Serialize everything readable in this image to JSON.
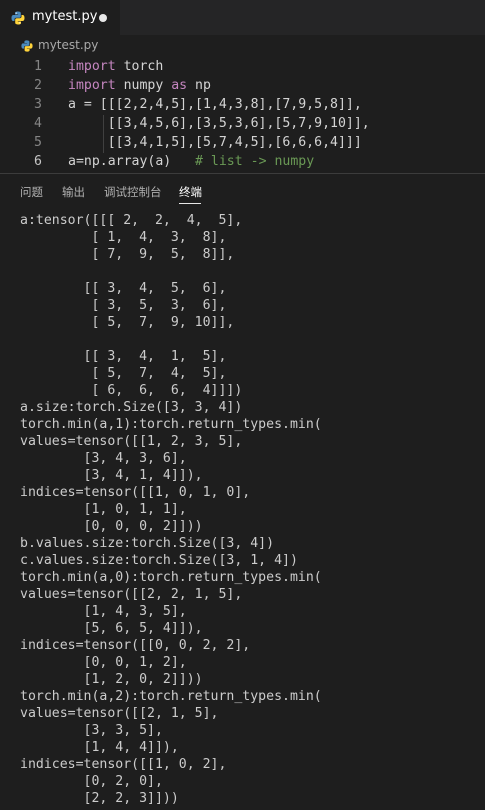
{
  "tab": {
    "filename": "mytest.py",
    "icon": "python-icon"
  },
  "breadcrumb": {
    "filename": "mytest.py"
  },
  "editor": {
    "lines": [
      {
        "number": "1",
        "code": [
          {
            "t": "import",
            "k": "kw"
          },
          {
            "t": " torch",
            "k": ""
          }
        ]
      },
      {
        "number": "2",
        "code": [
          {
            "t": "import",
            "k": "kw"
          },
          {
            "t": " numpy ",
            "k": ""
          },
          {
            "t": "as",
            "k": "kw"
          },
          {
            "t": " np",
            "k": ""
          }
        ]
      },
      {
        "number": "3",
        "code": [
          {
            "t": "a = [[[2,2,4,5],[1,4,3,8],[7,9,5,8]],",
            "k": ""
          }
        ]
      },
      {
        "number": "4",
        "code": [
          {
            "t": "     [[3,4,5,6],[3,5,3,6],[5,7,9,10]],",
            "k": ""
          }
        ]
      },
      {
        "number": "5",
        "code": [
          {
            "t": "     [[3,4,1,5],[5,7,4,5],[6,6,6,4]]]",
            "k": ""
          }
        ]
      },
      {
        "number": "6",
        "code": [
          {
            "t": "a=np.array(a)   ",
            "k": ""
          },
          {
            "t": "# list -> numpy",
            "k": "cm"
          }
        ]
      }
    ]
  },
  "panel": {
    "tabs": [
      {
        "label": "问题",
        "active": false
      },
      {
        "label": "输出",
        "active": false
      },
      {
        "label": "调试控制台",
        "active": false
      },
      {
        "label": "终端",
        "active": true
      }
    ]
  },
  "terminal": {
    "lines": [
      "a:tensor([[[ 2,  2,  4,  5],",
      "         [ 1,  4,  3,  8],",
      "         [ 7,  9,  5,  8]],",
      "",
      "        [[ 3,  4,  5,  6],",
      "         [ 3,  5,  3,  6],",
      "         [ 5,  7,  9, 10]],",
      "",
      "        [[ 3,  4,  1,  5],",
      "         [ 5,  7,  4,  5],",
      "         [ 6,  6,  6,  4]]])",
      "a.size:torch.Size([3, 3, 4])",
      "torch.min(a,1):torch.return_types.min(",
      "values=tensor([[1, 2, 3, 5],",
      "        [3, 4, 3, 6],",
      "        [3, 4, 1, 4]]),",
      "indices=tensor([[1, 0, 1, 0],",
      "        [1, 0, 1, 1],",
      "        [0, 0, 0, 2]]))",
      "b.values.size:torch.Size([3, 4])",
      "c.values.size:torch.Size([3, 1, 4])",
      "torch.min(a,0):torch.return_types.min(",
      "values=tensor([[2, 2, 1, 5],",
      "        [1, 4, 3, 5],",
      "        [5, 6, 5, 4]]),",
      "indices=tensor([[0, 0, 2, 2],",
      "        [0, 0, 1, 2],",
      "        [1, 2, 0, 2]]))",
      "torch.min(a,2):torch.return_types.min(",
      "values=tensor([[2, 1, 5],",
      "        [3, 3, 5],",
      "        [1, 4, 4]]),",
      "indices=tensor([[1, 0, 2],",
      "        [0, 2, 0],",
      "        [2, 2, 3]]))"
    ]
  },
  "colors": {
    "background": "#1e1e1e",
    "tabbar": "#252526",
    "keyword": "#c586c0",
    "comment": "#6a9955",
    "python_blue": "#4b8bbe",
    "python_yellow": "#ffd43b"
  }
}
